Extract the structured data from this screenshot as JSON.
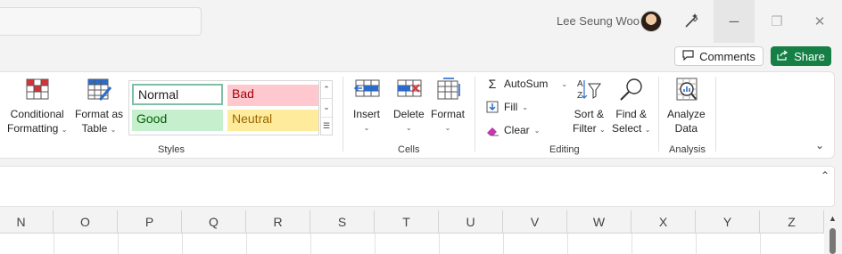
{
  "titlebar": {
    "user_name": "Lee Seung Woo",
    "avatar_icon": "user-avatar-icon",
    "designer_icon": "magic-wand-icon",
    "minimize": "─",
    "restore": "❐",
    "close": "✕"
  },
  "commands": {
    "comments_label": "Comments",
    "comments_icon": "comment-icon",
    "share_label": "Share",
    "share_icon": "share-icon",
    "share_color": "#167f45"
  },
  "ribbon": {
    "conditional_formatting": {
      "line1": "Conditional",
      "line2": "Formatting"
    },
    "format_as_table": {
      "line1": "Format as",
      "line2": "Table"
    },
    "styles": {
      "label": "Styles",
      "items": [
        {
          "label": "Normal",
          "bg": "#ffffff",
          "fg": "#242424"
        },
        {
          "label": "Bad",
          "bg": "#ffc7ce",
          "fg": "#9c0006"
        },
        {
          "label": "Good",
          "bg": "#c6efce",
          "fg": "#006100"
        },
        {
          "label": "Neutral",
          "bg": "#ffeb9c",
          "fg": "#9c6500"
        }
      ]
    },
    "cells": {
      "label": "Cells",
      "insert": "Insert",
      "delete": "Delete",
      "format": "Format"
    },
    "editing": {
      "label": "Editing",
      "autosum": "AutoSum",
      "fill": "Fill",
      "clear": "Clear",
      "sort_filter": {
        "line1": "Sort &",
        "line2": "Filter"
      },
      "find_select": {
        "line1": "Find &",
        "line2": "Select"
      }
    },
    "analysis": {
      "label": "Analysis",
      "analyze_data": {
        "line1": "Analyze",
        "line2": "Data"
      }
    }
  },
  "grid": {
    "columns": [
      "N",
      "O",
      "P",
      "Q",
      "R",
      "S",
      "T",
      "U",
      "V",
      "W",
      "X",
      "Y",
      "Z"
    ]
  }
}
